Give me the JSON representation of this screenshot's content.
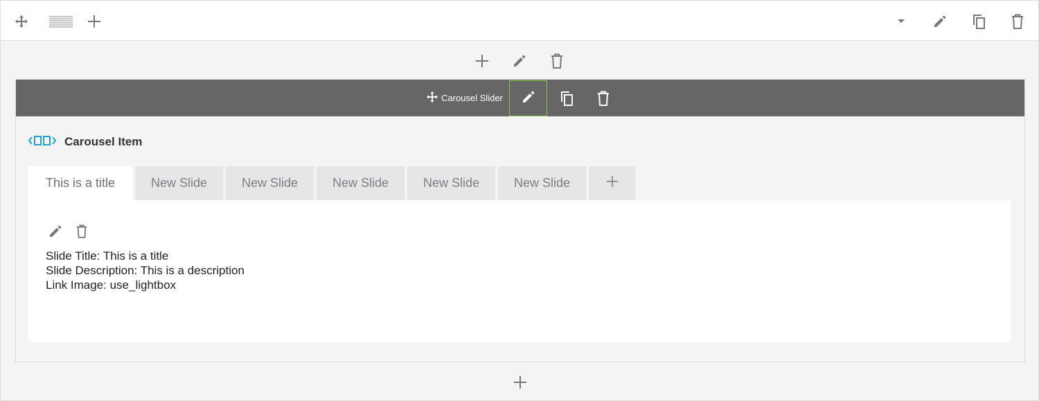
{
  "row_toolbar": {
    "icons": [
      "move-icon",
      "grid-icon",
      "plus-icon",
      "caret-down-icon",
      "pencil-icon",
      "duplicate-icon",
      "trash-icon"
    ]
  },
  "column_actions": {
    "icons": [
      "plus-icon",
      "pencil-icon",
      "trash-icon"
    ]
  },
  "module": {
    "title": "Carousel Slider",
    "icons": [
      "move-icon",
      "pencil-icon",
      "duplicate-icon",
      "trash-icon"
    ]
  },
  "item": {
    "label": "Carousel Item",
    "icon": "carousel-icon",
    "accent_color": "#1e9fd8"
  },
  "tabs": [
    {
      "label": "This is a title",
      "active": true
    },
    {
      "label": "New Slide",
      "active": false
    },
    {
      "label": "New Slide",
      "active": false
    },
    {
      "label": "New Slide",
      "active": false
    },
    {
      "label": "New Slide",
      "active": false
    },
    {
      "label": "New Slide",
      "active": false
    }
  ],
  "add_tab_label": "+",
  "slide": {
    "lines": [
      "Slide Title: This is a title",
      "Slide Description: This is a description",
      "Link Image: use_lightbox"
    ]
  },
  "colors": {
    "module_bar": "#666666",
    "active_edit_border": "#8bc34a",
    "icon_gray": "#777777"
  }
}
